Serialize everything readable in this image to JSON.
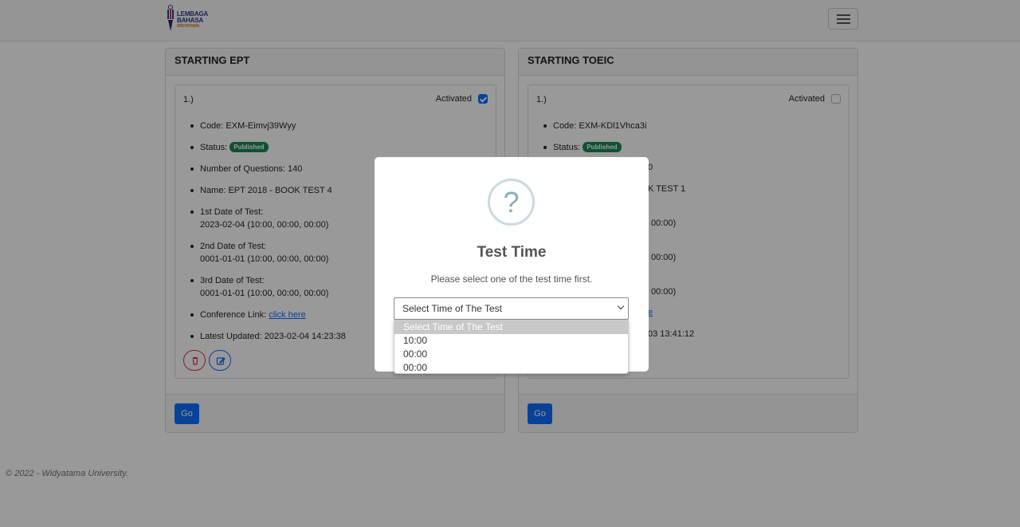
{
  "navbar": {
    "logo": {
      "line1": "LEMBAGA",
      "line2": "BAHASA",
      "line3": "WIDYATAMA"
    }
  },
  "cards": [
    {
      "header": "STARTING EPT",
      "number": "1.)",
      "activated_label": "Activated",
      "activated": true,
      "code": "Code: EXM-Eimvj39Wyy",
      "status_prefix": "Status:",
      "status_badge": "Published",
      "questions": "Number of Questions: 140",
      "name": "Name: EPT 2018 - BOOK TEST 4",
      "date1_label": "1st Date of Test:",
      "date1_value": "2023-02-04 (10:00, 00:00, 00:00)",
      "date2_label": "2nd Date of Test:",
      "date2_value": "0001-01-01 (10:00, 00:00, 00:00)",
      "date3_label": "3rd Date of Test:",
      "date3_value": "0001-01-01 (10:00, 00:00, 00:00)",
      "conference_prefix": "Conference Link:",
      "conference_link": "click here",
      "updated": "Latest Updated: 2023-02-04 14:23:38",
      "go_label": "Go"
    },
    {
      "header": "STARTING TOEIC",
      "number": "1.)",
      "activated_label": "Activated",
      "activated": false,
      "code": "Code: EXM-KDl1Vhca3i",
      "status_prefix": "Status:",
      "status_badge": "Published",
      "questions_tail": "0",
      "name_tail": "K TEST 1",
      "date1_tail": "00:00)",
      "date2_tail": "00:00)",
      "date3_tail": "00:00)",
      "conference_tail": "e",
      "updated_tail": "03 13:41:12",
      "go_label": "Go"
    }
  ],
  "footer": {
    "text": "© 2022 - Widyatama University."
  },
  "modal": {
    "icon": "?",
    "title": "Test Time",
    "text": "Please select one of the test time first.",
    "select_value": "Select Time of The Test",
    "options": [
      "Select Time of The Test",
      "10:00",
      "00:00",
      "00:00"
    ]
  },
  "colors": {
    "primary": "#0d6efd",
    "success": "#198754",
    "danger": "#dc3545"
  }
}
